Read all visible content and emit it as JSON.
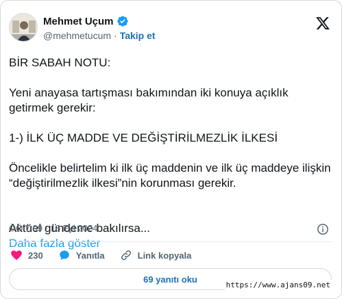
{
  "author": {
    "name": "Mehmet Uçum",
    "handle": "@mehmetucum",
    "separator": "·",
    "follow_label": "Takip et"
  },
  "tweet": {
    "paragraphs": [
      "BİR SABAH NOTU:",
      "Yeni anayasa tartışması bakımından iki konuya açıklık getirmek gerekir:",
      "1-) İLK ÜÇ MADDE VE DEĞİŞTİRİLMEZLİK İLKESİ",
      "Öncelikle belirtelim ki ilk üç maddenin ve ilk üç maddeye ilişkin “değiştirilmezlik ilkesi”nin korunması gerekir."
    ],
    "truncated_text": "Aktüel gündeme bakılırsa...",
    "show_more_label": "Daha fazla göster",
    "timestamp": "ÖÖ 7:09 · 18 Eyl 2024"
  },
  "actions": {
    "like_count": "230",
    "reply_label": "Yanıtla",
    "copy_link_label": "Link kopyala"
  },
  "replies_button_label": "69 yanıtı oku",
  "watermark": "https://www.ajans09.net",
  "colors": {
    "accent": "#1d9bf0",
    "like": "#f91880",
    "text": "#0f1419",
    "muted": "#536471"
  }
}
